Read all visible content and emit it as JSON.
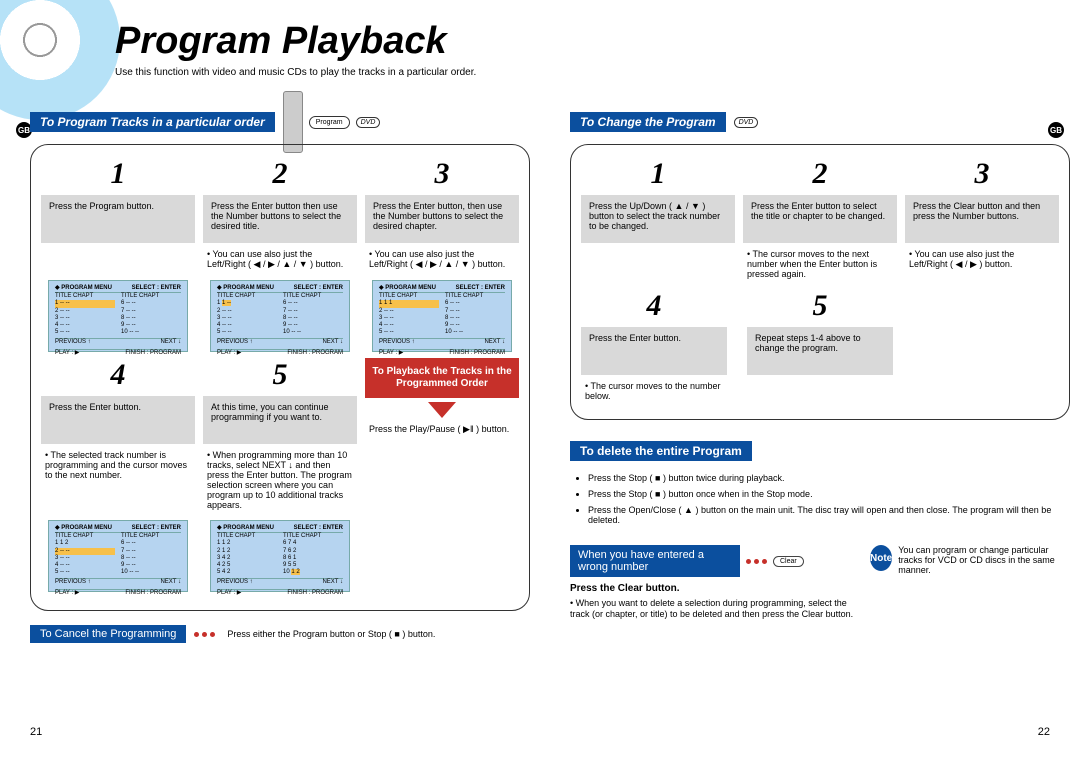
{
  "title": "Program Playback",
  "subtitle": "Use this function with video and music CDs to play the tracks in a particular order.",
  "gb_label": "GB",
  "page_left": "21",
  "page_right": "22",
  "left": {
    "header": "To Program Tracks in a particular order",
    "program_label": "Program",
    "dvd": "DVD",
    "steps": {
      "s1": {
        "num": "1",
        "text": "Press the Program button."
      },
      "s2": {
        "num": "2",
        "text": "Press the Enter button then use the Number buttons to select the desired title.",
        "tip": "• You can use  also just the Left/Right ( ◀ / ▶ / ▲ / ▼ ) button."
      },
      "s3": {
        "num": "3",
        "text": "Press the Enter button, then use the Number buttons to select the desired chapter.",
        "tip": "• You can use also just the Left/Right ( ◀ / ▶ / ▲ / ▼ ) button."
      },
      "s4": {
        "num": "4",
        "text": "Press the Enter button.",
        "tip": "• The selected track number is programming and the cursor moves to the next number."
      },
      "s5": {
        "num": "5",
        "text": "At this time, you can continue programming if you want to.",
        "tip": "• When programming more than 10 tracks, select NEXT ↓ and then press the Enter button. The program selection screen where you can program up to 10 additional tracks appears."
      }
    },
    "playback_box": "To Playback the Tracks in the Programmed Order",
    "playpause_text": "Press the Play/Pause ( ▶ǁ ) button.",
    "osd": {
      "hdr_left": "◆ PROGRAM MENU",
      "hdr_right": "SELECT : ENTER",
      "col_hdr": "TITLE CHAPT",
      "ftr_prev": "PREVIOUS ↑",
      "ftr_next": "NEXT ↓",
      "ftr_play": "PLAY : ▶",
      "ftr_finish": "FINISH : PROGRAM"
    },
    "cancel_label": "To Cancel the Programming",
    "cancel_text": "Press either the Program button or Stop ( ■ ) button."
  },
  "right": {
    "header": "To Change the Program",
    "dvd": "DVD",
    "steps": {
      "s1": {
        "num": "1",
        "text": "Press the Up/Down ( ▲ / ▼ ) button to select the track number to be changed."
      },
      "s2": {
        "num": "2",
        "text": "Press the Enter button to select the title or chapter to be changed.",
        "tip": "• The cursor moves to the next number when the Enter button is pressed again."
      },
      "s3": {
        "num": "3",
        "text": "Press the Clear button and then press the Number buttons.",
        "tip": "• You can use also just the Left/Right ( ◀  / ▶ ) button."
      },
      "s4": {
        "num": "4",
        "text": "Press the Enter button.",
        "tip": "• The cursor moves to the number below."
      },
      "s5": {
        "num": "5",
        "text": "Repeat steps 1-4 above to change the program."
      }
    },
    "delete": {
      "header": "To delete the entire Program",
      "items": [
        "Press the Stop ( ■ ) button twice during playback.",
        "Press the Stop ( ■ ) button once when in the Stop mode.",
        "Press the Open/Close ( ▲ ) button on the main unit. The disc tray will open and then close. The program will then be deleted."
      ]
    },
    "wrong": {
      "label": "When you have entered a wrong number",
      "clear_btn": "Clear",
      "heading": "Press the Clear button.",
      "text": "• When you want to delete a selection during programming, select the track (or chapter, or title) to be deleted and then press the Clear button."
    },
    "note": {
      "badge": "Note",
      "text": "You can program or change particular tracks for VCD or CD discs in the same manner."
    }
  }
}
